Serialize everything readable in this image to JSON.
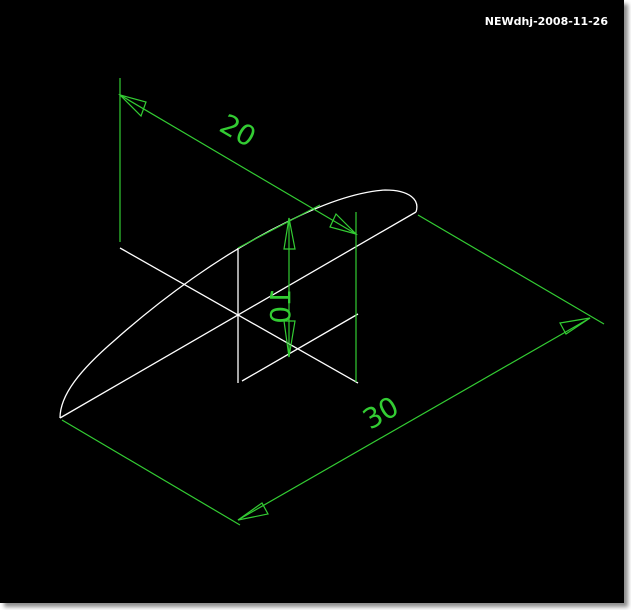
{
  "watermark": "NEWdhj-2008-11-26",
  "colors": {
    "background": "#000000",
    "geometry": "#ffffff",
    "dimension": "#33cc33"
  },
  "dimensions": {
    "depth": "20",
    "height": "10",
    "length": "30"
  }
}
